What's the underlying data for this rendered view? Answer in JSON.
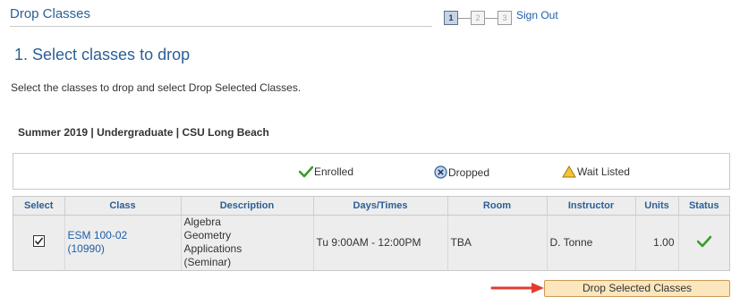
{
  "header": {
    "title": "Drop Classes",
    "sign_out": "Sign Out"
  },
  "steps": [
    "1",
    "2",
    "3"
  ],
  "section_title": "1.  Select classes to drop",
  "instructions": "Select the classes to drop and select Drop Selected Classes.",
  "term": "Summer 2019 | Undergraduate | CSU Long Beach",
  "legend": {
    "enrolled": "Enrolled",
    "dropped": "Dropped",
    "wait_listed": "Wait Listed"
  },
  "table": {
    "columns": [
      "Select",
      "Class",
      "Description",
      "Days/Times",
      "Room",
      "Instructor",
      "Units",
      "Status"
    ],
    "rows": [
      {
        "selected": true,
        "class_line1": "ESM 100-02",
        "class_line2": "(10990)",
        "description": [
          "Algebra",
          "Geometry",
          "Applications",
          "(Seminar)"
        ],
        "days_times": "Tu 9:00AM - 12:00PM",
        "room": "TBA",
        "instructor": "D. Tonne",
        "units": "1.00",
        "status": "enrolled-check-icon"
      }
    ]
  },
  "drop_button": "Drop Selected Classes",
  "colors": {
    "link": "#1f5ea8",
    "heading": "#2b5f97",
    "button_bg": "#fbe6bd",
    "arrow": "#e03c31",
    "check": "#3c9b2c"
  }
}
